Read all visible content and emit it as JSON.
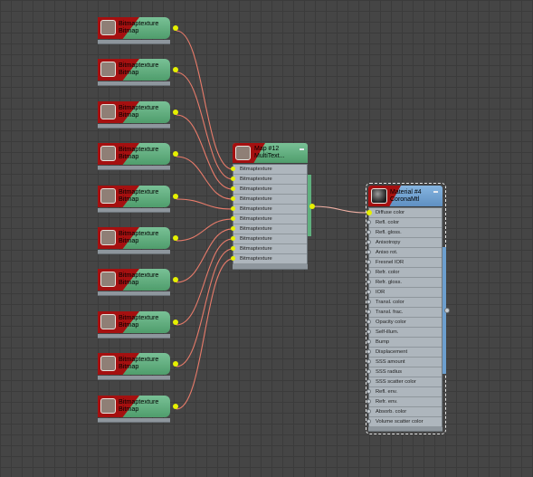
{
  "bitmap_nodes": [
    {
      "name": "Bitmaptexture",
      "type": "Bitmap"
    },
    {
      "name": "Bitmaptexture",
      "type": "Bitmap"
    },
    {
      "name": "Bitmaptexture",
      "type": "Bitmap"
    },
    {
      "name": "Bitmaptexture",
      "type": "Bitmap"
    },
    {
      "name": "Bitmaptexture",
      "type": "Bitmap"
    },
    {
      "name": "Bitmaptexture",
      "type": "Bitmap"
    },
    {
      "name": "Bitmaptexture",
      "type": "Bitmap"
    },
    {
      "name": "Bitmaptexture",
      "type": "Bitmap"
    },
    {
      "name": "Bitmaptexture",
      "type": "Bitmap"
    },
    {
      "name": "Bitmaptexture",
      "type": "Bitmap"
    }
  ],
  "multitex_node": {
    "title": "Map #12",
    "subtitle": "MultiText...",
    "slots": [
      "Bitmaptexture",
      "Bitmaptexture",
      "Bitmaptexture",
      "Bitmaptexture",
      "Bitmaptexture",
      "Bitmaptexture",
      "Bitmaptexture",
      "Bitmaptexture",
      "Bitmaptexture",
      "Bitmaptexture"
    ]
  },
  "material_node": {
    "title": "Material #4",
    "subtitle": "CoronaMtl",
    "slots": [
      "Diffuse color",
      "Refl. color",
      "Refl. gloss.",
      "Anisotropy",
      "Aniso rot.",
      "Fresnel IOR",
      "Refr. color",
      "Refr. gloss.",
      "IOR",
      "Transl. color",
      "Transl. frac.",
      "Opacity color",
      "Self-illum.",
      "Bump",
      "Displacement",
      "SSS amount",
      "SSS radius",
      "SSS scatter color",
      "Refl. env.",
      "Refr. env.",
      "Absorb. color",
      "Volume scatter color"
    ]
  },
  "colors": {
    "background": "#454545",
    "wire": "#e87b6a",
    "node_green": "#5faf7e",
    "node_blue": "#6c9fcf",
    "header_red": "#a51010",
    "port_active": "#e6f000"
  }
}
